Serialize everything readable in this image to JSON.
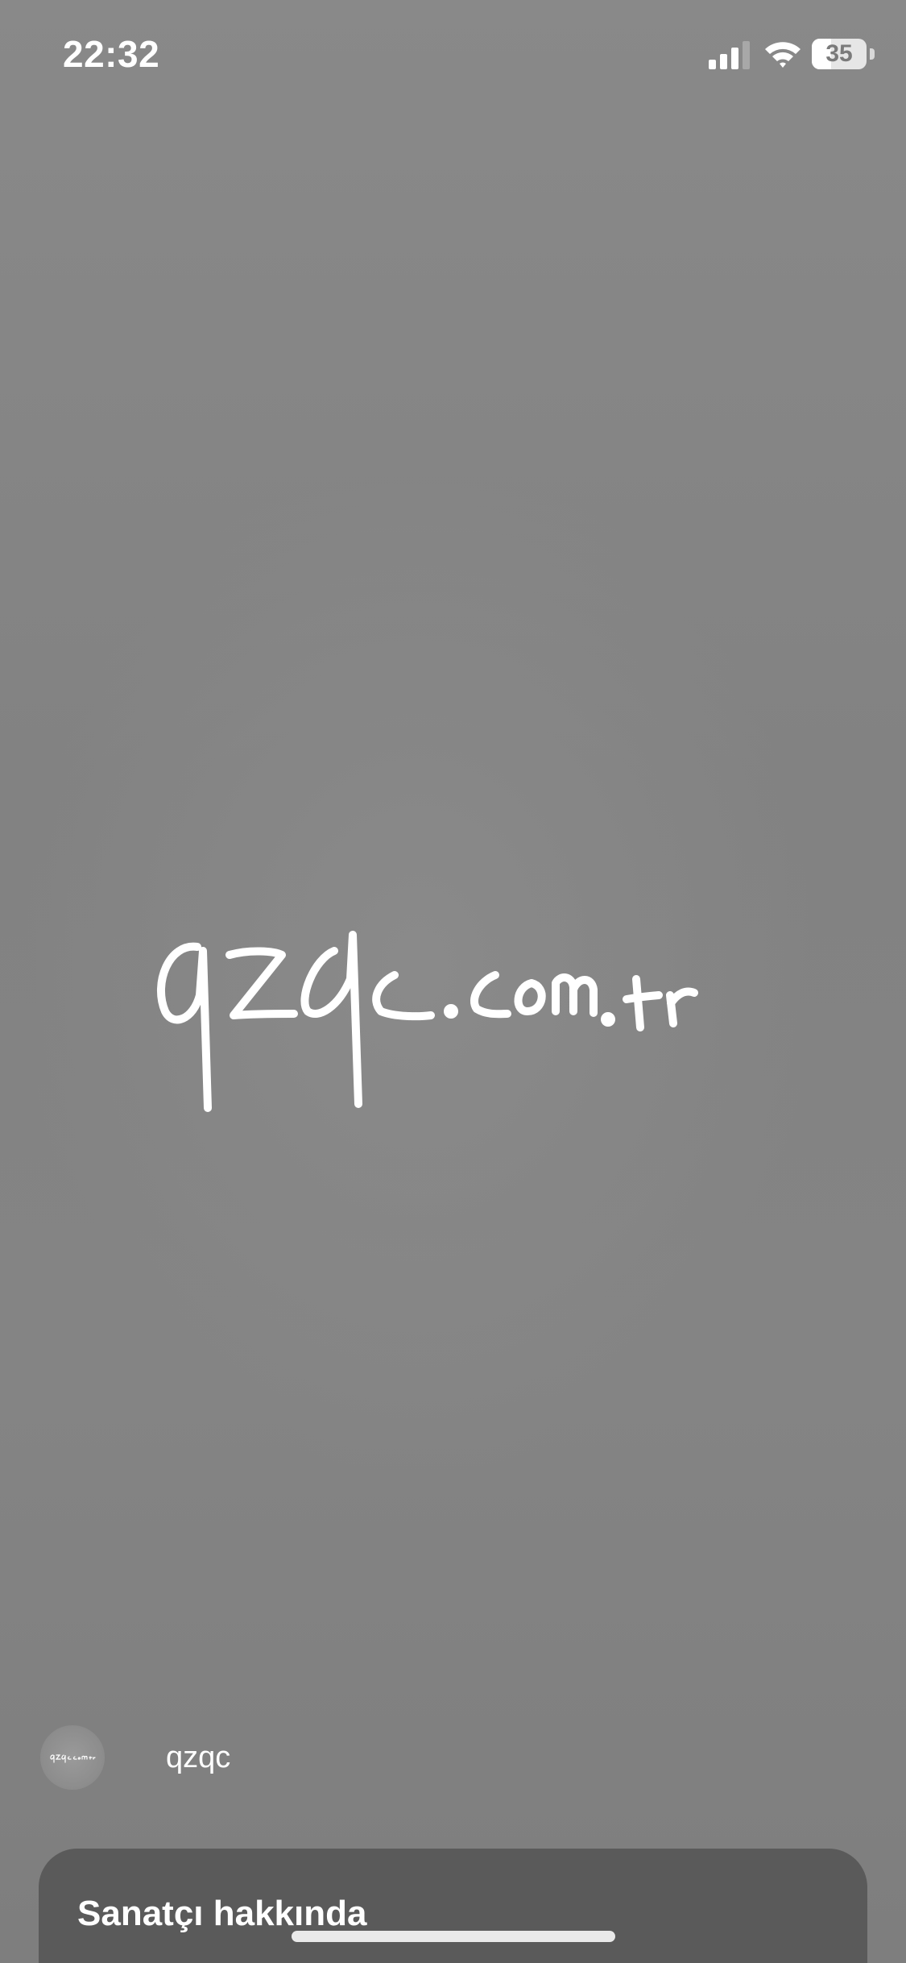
{
  "status_bar": {
    "time": "22:32",
    "battery_level": "35",
    "battery_fraction": 0.35,
    "icons": [
      "signal-icon",
      "wifi-icon",
      "battery-icon"
    ]
  },
  "artwork": {
    "handwritten_text": "qzqc.com.tr"
  },
  "artist": {
    "name": "qzqc",
    "avatar_text": "qzqc.com.tr"
  },
  "sheet": {
    "title": "Sanatçı hakkında"
  },
  "colors": {
    "background": "#858585",
    "sheet": "#5a5a5a",
    "text": "#ffffff"
  }
}
